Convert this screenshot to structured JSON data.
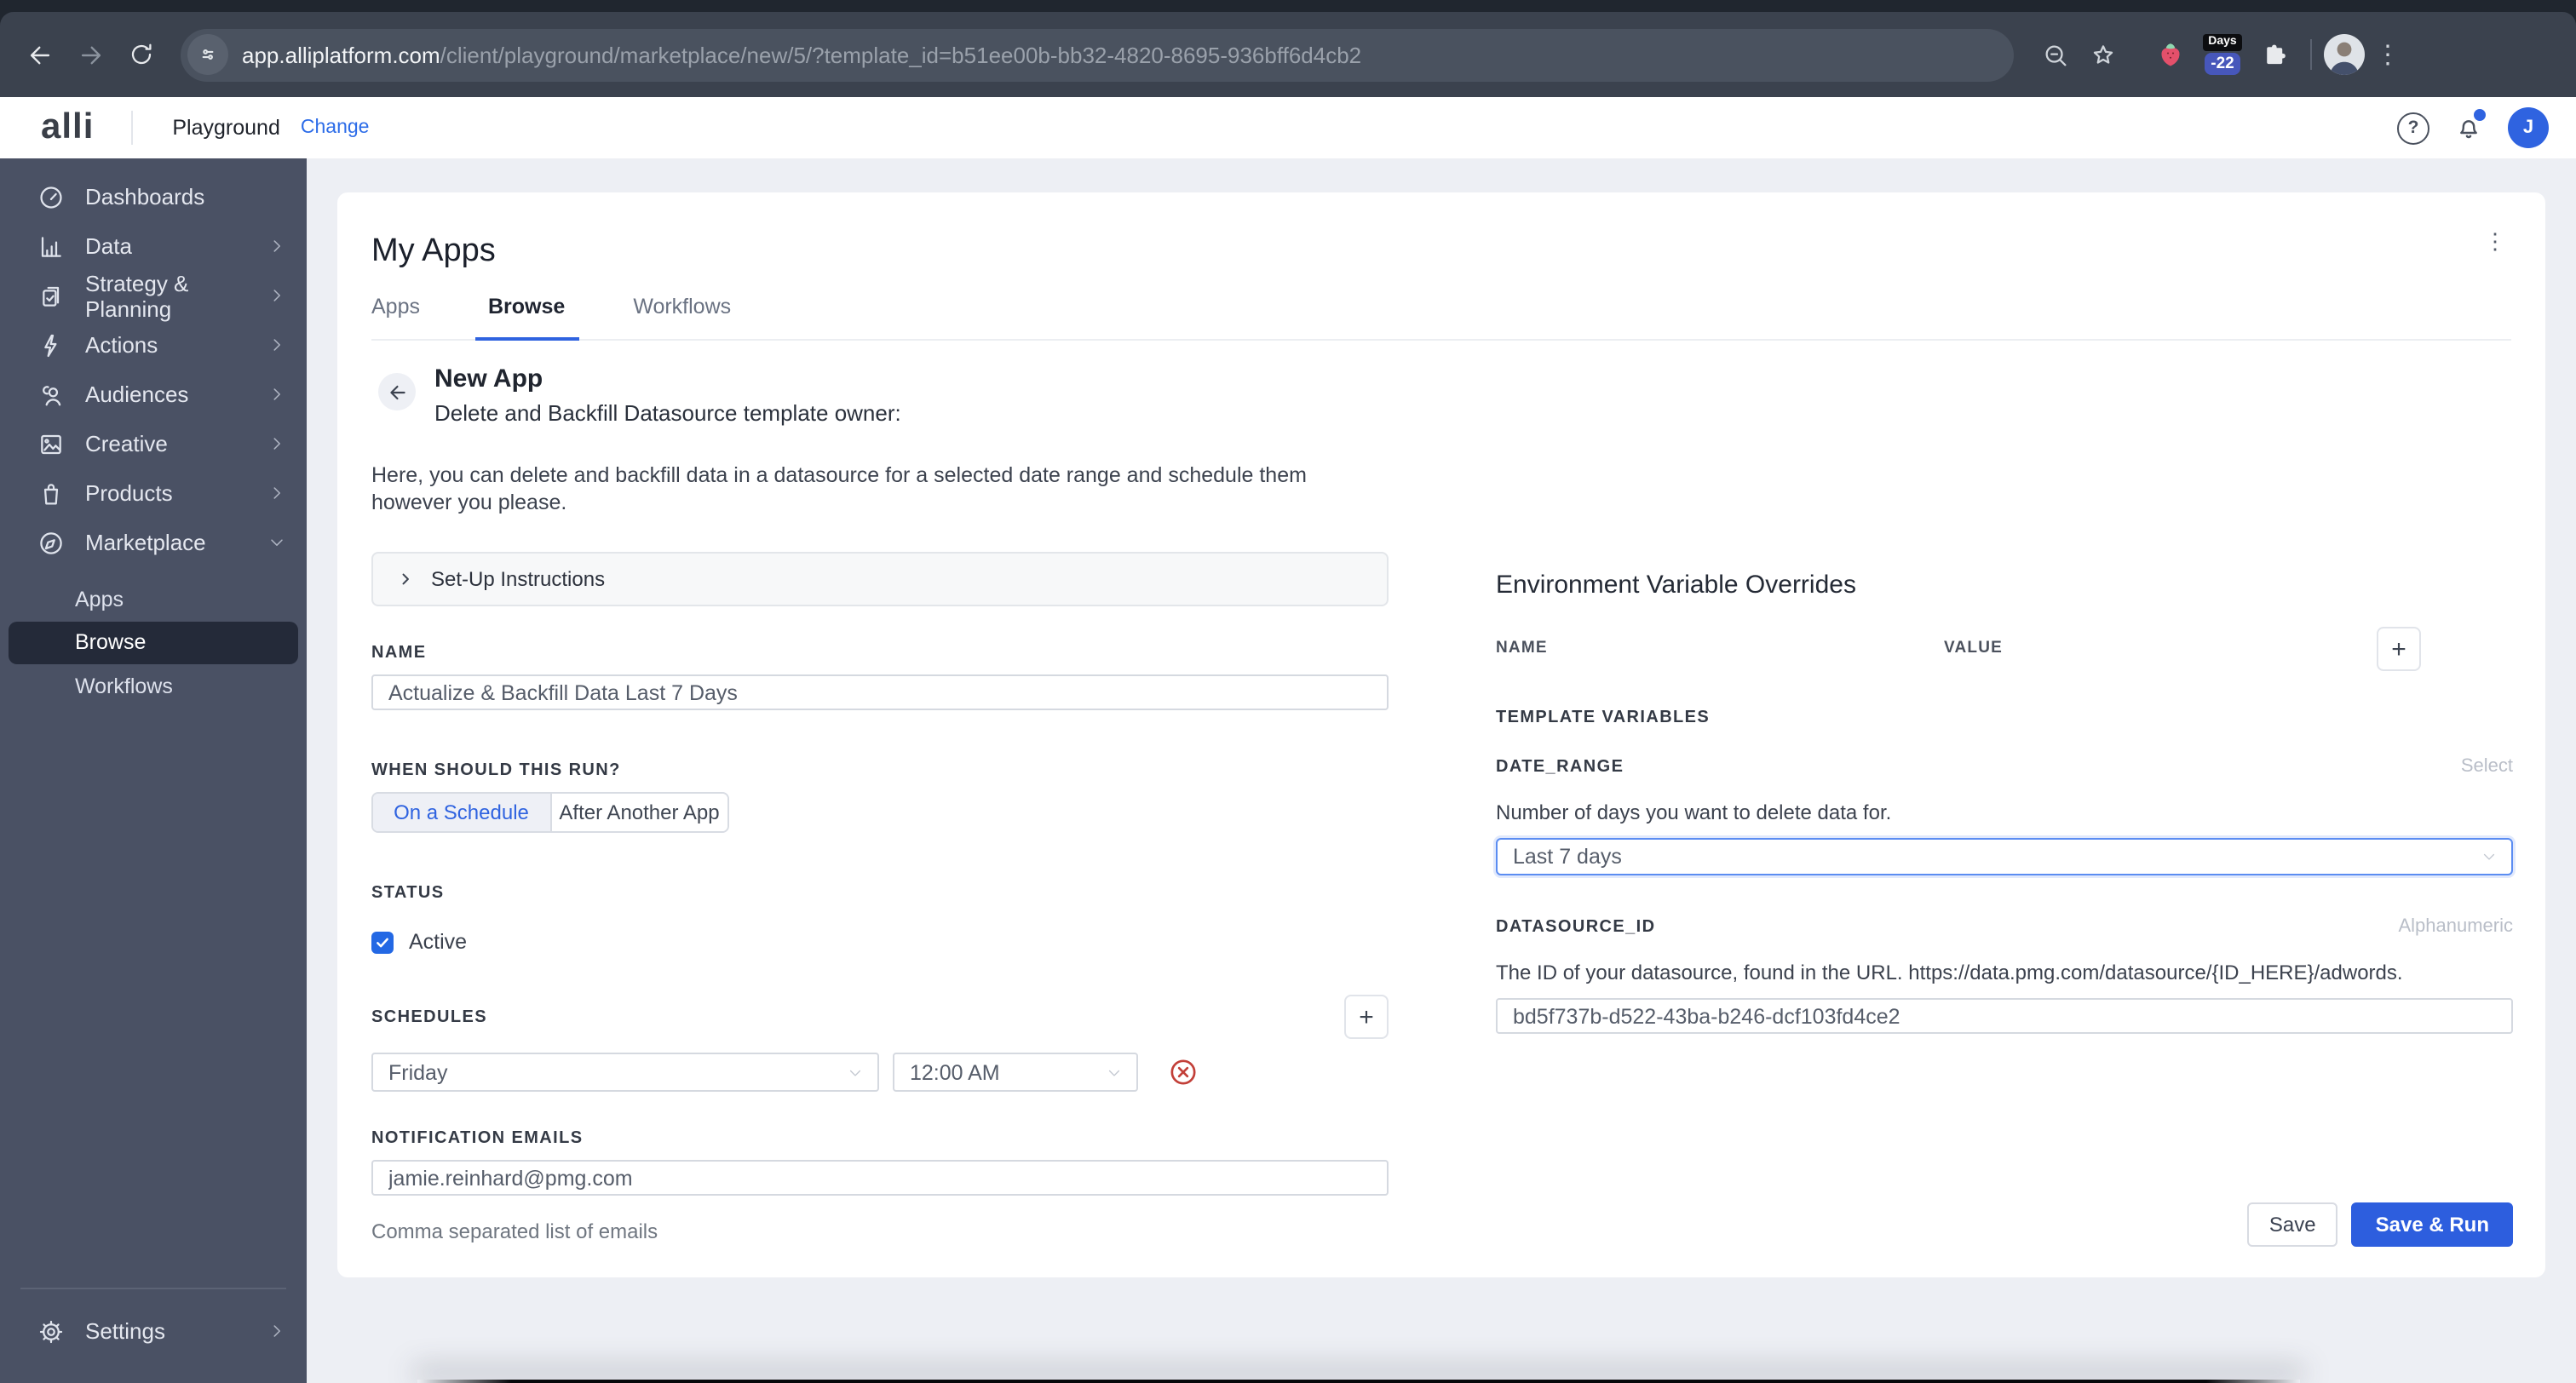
{
  "colors": {
    "accent": "#2f63e0",
    "save_run_button": "#2d5ede",
    "sidebar_bg": "#4a5164",
    "nav_selected_bg": "#242a39",
    "danger": "#c23f38"
  },
  "browser": {
    "url_domain": "app.alliplatform.com",
    "url_path": "/client/playground/marketplace/new/5/?template_id=b51ee00b-bb32-4820-8695-936bff6d4cb2",
    "days_ext_label": "Days",
    "days_ext_value": "-22"
  },
  "header": {
    "logo": "alli",
    "workspace": "Playground",
    "change_link": "Change",
    "avatar_initial": "J"
  },
  "sidebar": {
    "items": [
      {
        "label": "Dashboards"
      },
      {
        "label": "Data"
      },
      {
        "label": "Strategy & Planning"
      },
      {
        "label": "Actions"
      },
      {
        "label": "Audiences"
      },
      {
        "label": "Creative"
      },
      {
        "label": "Products"
      },
      {
        "label": "Marketplace"
      }
    ],
    "sub_items": [
      {
        "label": "Apps"
      },
      {
        "label": "Browse"
      },
      {
        "label": "Workflows"
      }
    ],
    "settings": "Settings"
  },
  "main": {
    "title": "My Apps",
    "tabs": [
      {
        "label": "Apps"
      },
      {
        "label": "Browse"
      },
      {
        "label": "Workflows"
      }
    ],
    "app": {
      "title": "New App",
      "subtitle": "Delete and Backfill Datasource template owner:",
      "description": "Here, you can delete and backfill data in a datasource for a selected date range and schedule them however you please.",
      "setup_instructions": "Set-Up Instructions",
      "name_label": "NAME",
      "name_value": "Actualize & Backfill Data Last 7 Days",
      "run_label": "WHEN SHOULD THIS RUN?",
      "run_option_schedule": "On a Schedule",
      "run_option_after": "After Another App",
      "status_label": "STATUS",
      "status_checkbox_label": "Active",
      "schedules_label": "SCHEDULES",
      "schedule_day": "Friday",
      "schedule_time": "12:00 AM",
      "emails_label": "NOTIFICATION EMAILS",
      "emails_value": "jamie.reinhard@pmg.com",
      "emails_helper": "Comma separated list of emails"
    },
    "env": {
      "title": "Environment Variable Overrides",
      "name_col": "NAME",
      "value_col": "VALUE",
      "template_vars_label": "TEMPLATE VARIABLES",
      "date_range": {
        "label": "DATE_RANGE",
        "hint": "Select",
        "description": "Number of days you want to delete data for.",
        "value": "Last 7 days"
      },
      "datasource": {
        "label": "DATASOURCE_ID",
        "hint": "Alphanumeric",
        "description": "The ID of your datasource, found in the URL. https://data.pmg.com/datasource/{ID_HERE}/adwords.",
        "value": "bd5f737b-d522-43ba-b246-dcf103fd4ce2"
      }
    },
    "footer": {
      "save": "Save",
      "save_run": "Save & Run"
    }
  }
}
